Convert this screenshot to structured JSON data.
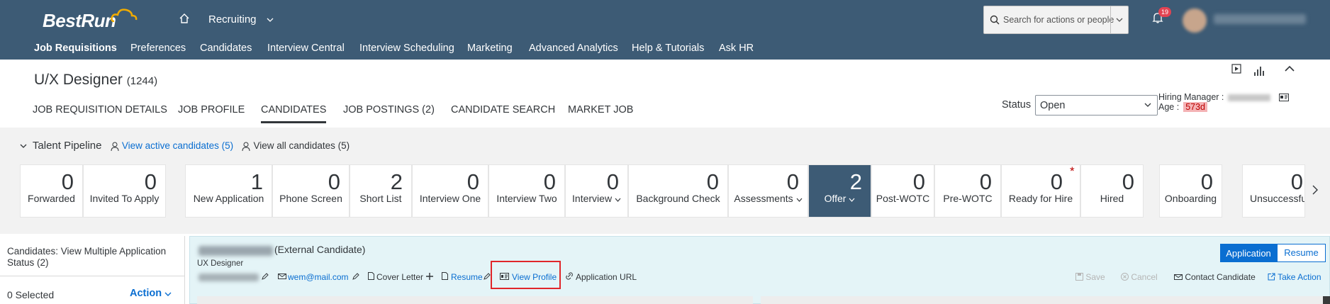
{
  "header": {
    "logo": "BestRun",
    "module": "Recruiting",
    "search_placeholder": "Search for actions or people",
    "notification_count": "19",
    "nav": [
      "Job Requisitions",
      "Preferences",
      "Candidates",
      "Interview Central",
      "Interview Scheduling",
      "Marketing",
      "Advanced Analytics",
      "Help & Tutorials",
      "Ask HR"
    ],
    "nav_active": "Job Requisitions"
  },
  "job": {
    "title": "U/X Designer",
    "req_id": "(1244)",
    "tabs": [
      "JOB REQUISITION DETAILS",
      "JOB PROFILE",
      "CANDIDATES",
      "JOB POSTINGS (2)",
      "CANDIDATE SEARCH",
      "MARKET JOB"
    ],
    "active_tab": "CANDIDATES",
    "status_label": "Status",
    "status_value": "Open",
    "hiring_manager_label": "Hiring Manager :",
    "age_label": "Age :",
    "age_value": "573d"
  },
  "pipeline": {
    "title": "Talent Pipeline",
    "view_active": "View active candidates (5)",
    "view_all": "View all candidates (5)",
    "tiles": [
      {
        "count": "0",
        "label": "Forwarded"
      },
      {
        "count": "0",
        "label": "Invited To Apply"
      },
      {
        "count": "1",
        "label": "New Application"
      },
      {
        "count": "0",
        "label": "Phone Screen"
      },
      {
        "count": "2",
        "label": "Short List"
      },
      {
        "count": "0",
        "label": "Interview One"
      },
      {
        "count": "0",
        "label": "Interview Two"
      },
      {
        "count": "0",
        "label": "Interview"
      },
      {
        "count": "0",
        "label": "Background Check"
      },
      {
        "count": "0",
        "label": "Assessments"
      },
      {
        "count": "2",
        "label": "Offer"
      },
      {
        "count": "0",
        "label": "Post-WOTC"
      },
      {
        "count": "0",
        "label": "Pre-WOTC"
      },
      {
        "count": "0",
        "label": "Ready for Hire"
      },
      {
        "count": "0",
        "label": "Hired"
      },
      {
        "count": "0",
        "label": "Onboarding"
      },
      {
        "count": "0",
        "label": "Unsuccessfu"
      }
    ],
    "selected": "Offer"
  },
  "sidebar": {
    "title": "Candidates: View Multiple Application Status (2)",
    "selected": "0 Selected",
    "action": "Action"
  },
  "candidate": {
    "type": "(External Candidate)",
    "role": "UX Designer",
    "email": "wem@mail.com",
    "cover_letter": "Cover Letter",
    "resume": "Resume",
    "view_profile": "View Profile",
    "application_url": "Application URL",
    "application_btn": "Application",
    "resume_btn": "Resume",
    "save": "Save",
    "cancel": "Cancel",
    "contact": "Contact Candidate",
    "take_action": "Take Action"
  },
  "colors": {
    "header_bg": "#3d5b75",
    "link": "#0a6ed1",
    "highlight": "#e0262a",
    "selected_tile": "#3d5b75"
  }
}
